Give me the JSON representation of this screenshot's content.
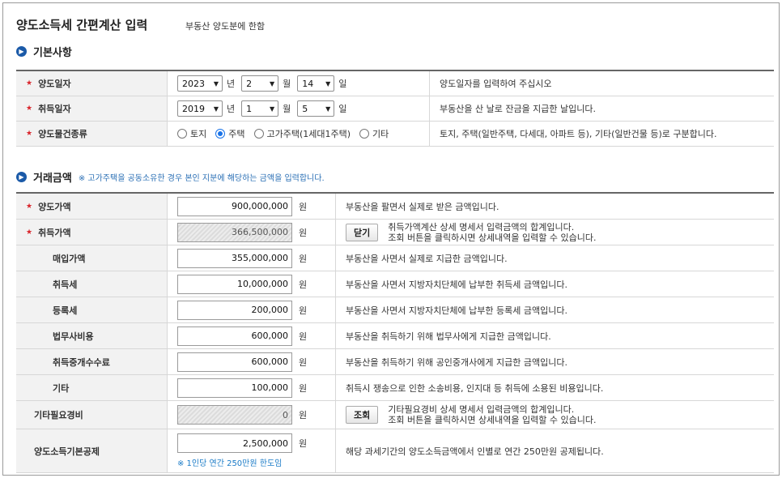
{
  "page": {
    "title": "양도소득세 간편계산 입력",
    "subtitle": "부동산 양도분에 한함"
  },
  "basic": {
    "heading": "기본사항",
    "transfer_date": {
      "label": "양도일자",
      "year": "2023",
      "year_unit": "년",
      "month": "2",
      "month_unit": "월",
      "day": "14",
      "day_unit": "일",
      "desc": "양도일자를 입력하여 주십시오"
    },
    "acquire_date": {
      "label": "취득일자",
      "year": "2019",
      "year_unit": "년",
      "month": "1",
      "month_unit": "월",
      "day": "5",
      "day_unit": "일",
      "desc": "부동산을 산 날로 잔금을 지급한 날입니다."
    },
    "property_type": {
      "label": "양도물건종류",
      "options": [
        "토지",
        "주택",
        "고가주택(1세대1주택)",
        "기타"
      ],
      "selected": "주택",
      "desc": "토지, 주택(일반주택, 다세대, 아파트 등), 기타(일반건물 등)로 구분합니다."
    }
  },
  "amounts": {
    "heading": "거래금액",
    "note": "※ 고가주택을 공동소유한 경우 본인 지분에 해당하는 금액을 입력합니다.",
    "unit": "원",
    "transfer_price": {
      "label": "양도가액",
      "value": "900,000,000",
      "desc": "부동산을 팔면서 실제로 받은 금액입니다."
    },
    "acquire_price": {
      "label": "취득가액",
      "value": "366,500,000",
      "button": "닫기",
      "desc1": "취득가액계산 상세 명세서 입력금액의 합계입니다.",
      "desc2": "조회 버튼을 클릭하시면 상세내역을 입력할 수 있습니다."
    },
    "purchase_price": {
      "label": "매입가액",
      "value": "355,000,000",
      "desc": "부동산을 사면서 실제로 지급한 금액입니다."
    },
    "acquisition_tax": {
      "label": "취득세",
      "value": "10,000,000",
      "desc": "부동산을 사면서 지방자치단체에 납부한 취득세 금액입니다."
    },
    "registration_tax": {
      "label": "등록세",
      "value": "200,000",
      "desc": "부동산을 사면서 지방자치단체에 납부한 등록세 금액입니다."
    },
    "legal_fee": {
      "label": "법무사비용",
      "value": "600,000",
      "desc": "부동산을 취득하기 위해 법무사에게 지급한 금액입니다."
    },
    "brokerage_fee": {
      "label": "취득중개수수료",
      "value": "600,000",
      "desc": "부동산을 취득하기 위해 공인중개사에게 지급한 금액입니다."
    },
    "other": {
      "label": "기타",
      "value": "100,000",
      "desc": "취득시 쟁송으로 인한 소송비용, 인지대 등 취득에 소용된 비용입니다."
    },
    "other_expenses": {
      "label": "기타필요경비",
      "value": "0",
      "button": "조회",
      "desc1": "기타필요경비 상세 명세서 입력금액의 합계입니다.",
      "desc2": "조회 버튼을 클릭하시면 상세내역을 입력할 수 있습니다."
    },
    "basic_deduction": {
      "label": "양도소득기본공제",
      "value": "2,500,000",
      "hint": "※ 1인당 연간 250만원 한도임",
      "desc": "해당 과세기간의 양도소득금액에서 인별로 연간 250만원 공제됩니다."
    }
  }
}
